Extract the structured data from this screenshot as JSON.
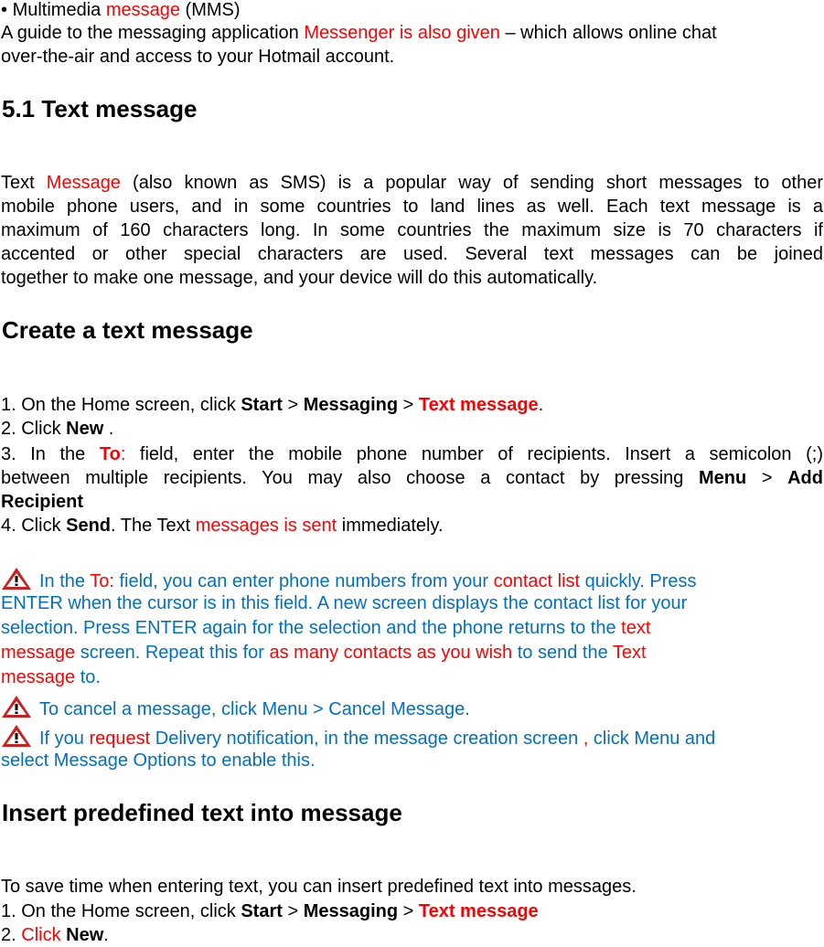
{
  "intro": {
    "bullet": "•",
    "mms_prefix": "Multimedia ",
    "mms_red": "message",
    "mms_suffix": " (MMS)",
    "guide_prefix": "A guide to the messaging application ",
    "guide_red": "Messenger is also given",
    "guide_suffix": " – which allows online chat",
    "guide_line2": "over-the-air and access to your Hotmail account."
  },
  "section_title": "5.1 Text message",
  "sms_paragraph": {
    "l1_prefix": "Text ",
    "l1_red": "Message",
    "l1_suffix": " (also known as SMS) is a popular way of sending short messages to other",
    "l2": "mobile phone users, and in some countries to land lines as well. Each text message is a",
    "l3": "maximum of 160 characters long. In some countries the maximum size is 70 characters if",
    "l4": "accented or other special characters are used. Several text messages can be joined",
    "l5": "together to make one message, and your device will do this automatically."
  },
  "create_heading": "Create a text message",
  "create_steps": {
    "s1_prefix": "1. On the Home screen, click ",
    "s1_start": "Start",
    "sep": " > ",
    "s1_messaging": "Messaging",
    "s1_text_message": "Text message",
    "s1_end": ".",
    "s2_prefix": "2. Click ",
    "s2_new": "New",
    "s2_end": " .",
    "s3_l1_prefix": "3. In the ",
    "s3_to": "To",
    "s3_colon": ":",
    "s3_l1_suffix": " field, enter the mobile phone number of recipients. Insert a semicolon (;)",
    "s3_l2_prefix": "between multiple recipients. You may also choose a contact by pressing ",
    "s3_menu": "Menu",
    "s3_add": "Add",
    "s3_recipient": "Recipient",
    "s4_prefix": "4. Click ",
    "s4_send": "Send",
    "s4_mid": ". The Text ",
    "s4_red": "messages is sent",
    "s4_suffix": " immediately."
  },
  "tips": {
    "icon": "warning-icon",
    "tip1": {
      "l1_a": "In the ",
      "l1_to": "To:",
      "l1_b": " field, you can enter phone numbers from your ",
      "l1_contact": "contact list",
      "l1_c": " quickly. Press",
      "l2": "ENTER when the cursor is in this field. A new screen displays the contact list for your",
      "l3_a": "selection. Press ENTER again for the selection and the phone returns to the ",
      "l3_text": "text",
      "l4_message": "message",
      "l4_a": " screen. Repeat this for ",
      "l4_red": "as many contacts as you wish",
      "l4_b": " to send the ",
      "l4_text": "Text",
      "l5_message": "message",
      "l5_a": " to."
    },
    "tip2": "To cancel a message, click Menu > Cancel Message.",
    "tip3": {
      "l1_a": "If you ",
      "l1_request": "request",
      "l1_b": " Delivery notification, in the message creation screen ",
      "l1_comma": ",",
      "l1_c": " click Menu and",
      "l2": "select Message Options to enable this."
    }
  },
  "insert_heading": "Insert predefined text into message",
  "insert_steps": {
    "intro": "To save time when entering text, you can insert predefined text into messages.",
    "s1_prefix": "1. On the Home screen, click ",
    "s1_start": "Start",
    "sep": " > ",
    "s1_messaging": "Messaging",
    "s1_text_message": "Text message",
    "s2_num": "2. ",
    "s2_click": "Click",
    "s2_space": " ",
    "s2_new": "New",
    "s2_end": "."
  },
  "colors": {
    "highlight_red": "#ff0000",
    "tip_blue": "#0070c0",
    "body_text": "#000000"
  }
}
